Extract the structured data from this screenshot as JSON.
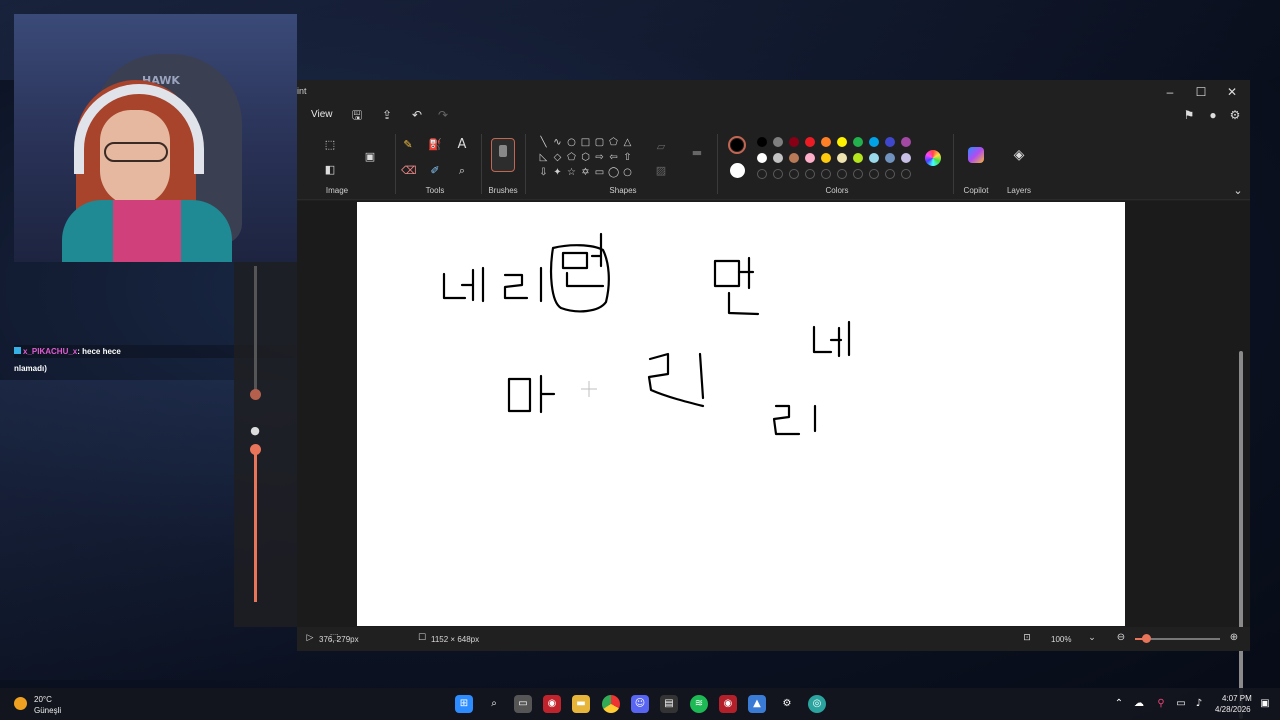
{
  "chat": {
    "username": "x_PIKACHU_x",
    "message": ": hece hece",
    "line2": "nlamadı)"
  },
  "webcam": {
    "chair_label": "HAWK"
  },
  "paint": {
    "title": "int",
    "window_buttons": {
      "minimize": "–",
      "maximize": "☐",
      "close": "✕"
    },
    "menu": {
      "view": "View"
    },
    "groups": {
      "image": "Image",
      "tools": "Tools",
      "brushes": "Brushes",
      "shapes": "Shapes",
      "colors": "Colors",
      "copilot": "Copilot",
      "layers": "Layers"
    },
    "tools": {
      "text": "A"
    },
    "colors": {
      "primary": "#000000",
      "secondary": "#ffffff",
      "row1": [
        "#000000",
        "#7f7f7f",
        "#880015",
        "#ed1c24",
        "#ff7f27",
        "#fff200",
        "#22b14c",
        "#00a2e8",
        "#3f48cc",
        "#a349a4"
      ],
      "row2": [
        "#ffffff",
        "#c3c3c3",
        "#b97a57",
        "#ffaec9",
        "#ffc90e",
        "#efe4b0",
        "#b5e61d",
        "#99d9ea",
        "#7092be",
        "#c8bfe7"
      ],
      "accent": "#c26552"
    },
    "canvas_text": [
      "네 리",
      "만",
      "만",
      "네",
      "마",
      "리",
      "리"
    ],
    "status": {
      "cursor": "376, 279px",
      "size": "1152 × 648px",
      "zoom": "100%"
    }
  },
  "taskbar": {
    "temp": "20°C",
    "weather": "Güneşli",
    "time": "4:07 PM",
    "date": "4/28/2026"
  }
}
